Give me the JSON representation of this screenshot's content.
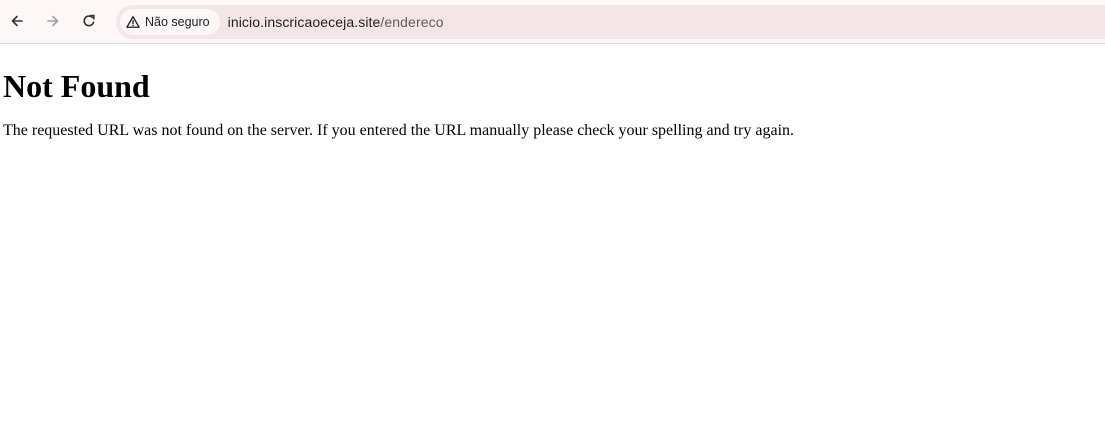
{
  "browser": {
    "icons": {
      "back": "arrow-left-icon",
      "forward": "arrow-right-icon",
      "reload": "reload-icon",
      "security": "warning-triangle-icon"
    },
    "security_label": "Não seguro",
    "url_host": "inicio.inscricaoeceja.site",
    "url_path": "/endereco",
    "colors": {
      "toolbar_bg": "#fdf7f7",
      "omnibox_bg": "#f3e5e8",
      "forward_disabled": "#9e9e9e"
    }
  },
  "page": {
    "heading": "Not Found",
    "message": "The requested URL was not found on the server. If you entered the URL manually please check your spelling and try again."
  }
}
